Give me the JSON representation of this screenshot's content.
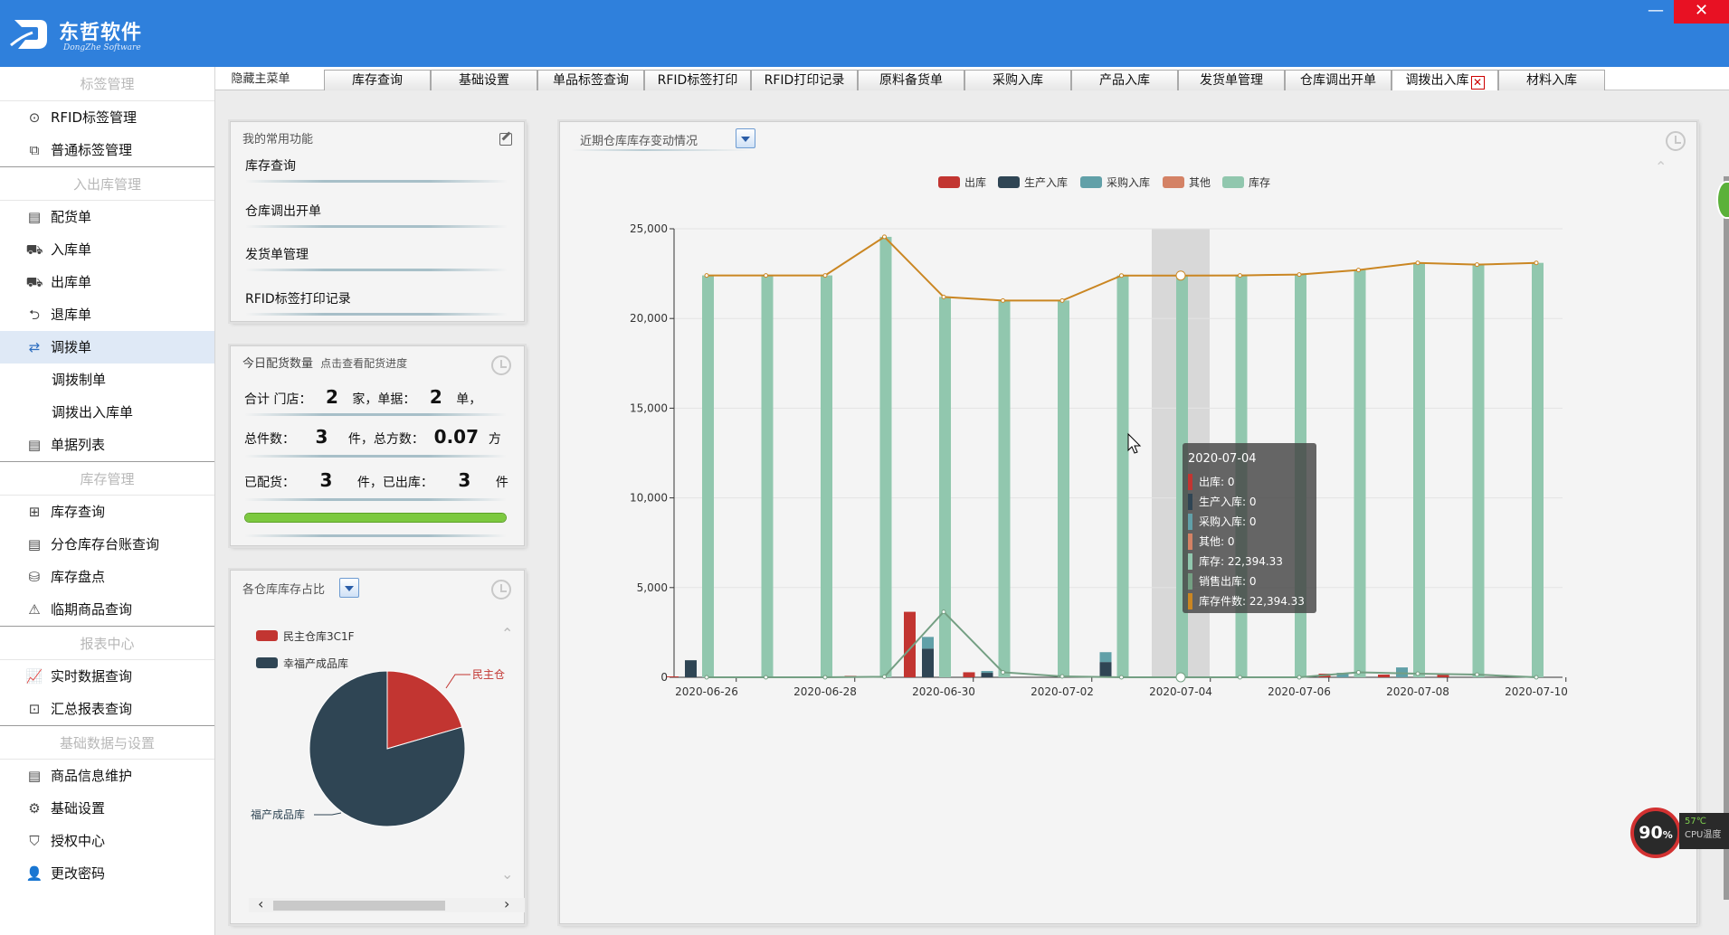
{
  "app": {
    "logo_name": "东哲软件",
    "logo_sub": "DongZhe Software",
    "min_glyph": "—",
    "close_glyph": "✕"
  },
  "sidebar": {
    "sections": [
      {
        "title": "标签管理",
        "items": [
          {
            "label": "RFID标签管理",
            "icon": "rfid-tag-icon",
            "glyph": "⊙"
          },
          {
            "label": "普通标签管理",
            "icon": "tag-icon",
            "glyph": "⧉"
          }
        ]
      },
      {
        "title": "入出库管理",
        "items": [
          {
            "label": "配货单",
            "icon": "printer-icon",
            "glyph": "▤"
          },
          {
            "label": "入库单",
            "icon": "forklift-in-icon",
            "glyph": "⛟"
          },
          {
            "label": "出库单",
            "icon": "truck-out-icon",
            "glyph": "⛟"
          },
          {
            "label": "退库单",
            "icon": "return-icon",
            "glyph": "⮌"
          },
          {
            "label": "调拨单",
            "icon": "transfer-icon",
            "glyph": "⇄",
            "active": true
          },
          {
            "label": "调拨制单",
            "sub": true
          },
          {
            "label": "调拨出入库单",
            "sub": true
          },
          {
            "label": "单据列表",
            "icon": "document-list-icon",
            "glyph": "▤"
          }
        ]
      },
      {
        "title": "库存管理",
        "items": [
          {
            "label": "库存查询",
            "icon": "warehouse-icon",
            "glyph": "⊞"
          },
          {
            "label": "分仓库存台账查询",
            "icon": "ledger-icon",
            "glyph": "▤"
          },
          {
            "label": "库存盘点",
            "icon": "database-icon",
            "glyph": "⛁"
          },
          {
            "label": "临期商品查询",
            "icon": "warning-icon",
            "glyph": "⚠"
          }
        ]
      },
      {
        "title": "报表中心",
        "items": [
          {
            "label": "实时数据查询",
            "icon": "chart-icon",
            "glyph": "📈"
          },
          {
            "label": "汇总报表查询",
            "icon": "report-icon",
            "glyph": "⊡"
          }
        ]
      },
      {
        "title": "基础数据与设置",
        "items": [
          {
            "label": "商品信息维护",
            "icon": "product-icon",
            "glyph": "▤"
          },
          {
            "label": "基础设置",
            "icon": "gear-icon",
            "glyph": "⚙"
          },
          {
            "label": "授权中心",
            "icon": "auth-icon",
            "glyph": "⛉"
          },
          {
            "label": "更改密码",
            "icon": "user-icon",
            "glyph": "👤"
          }
        ]
      }
    ]
  },
  "tabs": {
    "hide_label": "隐藏主菜单",
    "items": [
      "库存查询",
      "基础设置",
      "单品标签查询",
      "RFID标签打印",
      "RFID打印记录",
      "原料备货单",
      "采购入库",
      "产品入库",
      "发货单管理",
      "仓库调出开单",
      "调拨出入库",
      "材料入库"
    ],
    "close_glyph": "✕"
  },
  "favorites": {
    "title": "我的常用功能",
    "items": [
      "库存查询",
      "仓库调出开单",
      "发货单管理",
      "RFID标签打印记录"
    ]
  },
  "today": {
    "title": "今日配货数量",
    "link": "点击查看配货进度",
    "row1": {
      "a": "合计 门店：",
      "stores": "2",
      "b": "家，单据：",
      "docs": "2",
      "c": "单，"
    },
    "row2": {
      "a": "总件数：",
      "pieces": "3",
      "b": "件，总方数：",
      "volume": "0.07",
      "c": "方"
    },
    "row3": {
      "a": "已配货：",
      "allocated": "3",
      "b": "件，已出库：",
      "shipped": "3",
      "c": "件"
    },
    "progress": 1.0
  },
  "pie_panel": {
    "title": "各仓库库存占比",
    "legend": [
      {
        "name": "民主仓库3C1F",
        "color": "#c23531"
      },
      {
        "name": "幸福产成品库",
        "color": "#2f4554"
      }
    ],
    "label_a": "民主仓",
    "label_b": "福产成品库",
    "scroll_left": "‹",
    "scroll_right": "›"
  },
  "main_chart_panel": {
    "title": "近期仓库库存变动情况"
  },
  "chart_data": [
    {
      "type": "bar",
      "title": "近期仓库库存变动情况",
      "categories": [
        "2020-06-26",
        "2020-06-27",
        "2020-06-28",
        "2020-06-29",
        "2020-06-30",
        "2020-07-01",
        "2020-07-02",
        "2020-07-03",
        "2020-07-04",
        "2020-07-05",
        "2020-07-06",
        "2020-07-07",
        "2020-07-08",
        "2020-07-09",
        "2020-07-10"
      ],
      "x_tick_labels": [
        "2020-06-26",
        "2020-06-28",
        "2020-06-30",
        "2020-07-02",
        "2020-07-04",
        "2020-07-06",
        "2020-07-08",
        "2020-07-10"
      ],
      "y_tick_labels": [
        "0",
        "5,000",
        "10,000",
        "15,000",
        "20,000",
        "25,000"
      ],
      "ylim": [
        0,
        25000
      ],
      "series": [
        {
          "name": "出库",
          "color": "#c23531",
          "values": [
            50,
            0,
            0,
            80,
            3650,
            280,
            0,
            0,
            0,
            0,
            0,
            200,
            150,
            150,
            0
          ]
        },
        {
          "name": "生产入库",
          "color": "#2f4554",
          "values": [
            950,
            0,
            0,
            0,
            1600,
            250,
            0,
            850,
            0,
            0,
            0,
            0,
            0,
            0,
            0
          ]
        },
        {
          "name": "采购入库",
          "color": "#61a0a8",
          "values": [
            0,
            0,
            0,
            0,
            650,
            100,
            0,
            550,
            0,
            0,
            0,
            250,
            550,
            0,
            0
          ]
        },
        {
          "name": "其他",
          "color": "#d48265",
          "values": [
            0,
            0,
            0,
            0,
            0,
            0,
            0,
            0,
            0,
            0,
            0,
            0,
            0,
            0,
            0
          ]
        },
        {
          "name": "库存",
          "color": "#91c7ae",
          "values": [
            22400,
            22400,
            22400,
            24550,
            21200,
            21000,
            21000,
            22394,
            22394,
            22400,
            22450,
            22700,
            23100,
            23000,
            23100
          ]
        },
        {
          "name": "销售出库",
          "color": "#749f83",
          "type": "line",
          "values": [
            0,
            0,
            0,
            30,
            3650,
            280,
            50,
            0,
            0,
            0,
            0,
            280,
            200,
            150,
            0
          ]
        },
        {
          "name": "库存件数",
          "color": "#ca8622",
          "type": "line",
          "values": [
            22400,
            22400,
            22400,
            24550,
            21200,
            21000,
            21000,
            22394,
            22394,
            22400,
            22450,
            22700,
            23100,
            23000,
            23100
          ]
        }
      ],
      "tooltip": {
        "date": "2020-07-04",
        "rows": [
          {
            "label": "出库: 0",
            "color": "#c23531"
          },
          {
            "label": "生产入库: 0",
            "color": "#2f4554"
          },
          {
            "label": "采购入库: 0",
            "color": "#61a0a8"
          },
          {
            "label": "其他: 0",
            "color": "#d48265"
          },
          {
            "label": "库存: 22,394.33",
            "color": "#91c7ae"
          },
          {
            "label": "销售出库: 0",
            "color": "#749f83"
          },
          {
            "label": "库存件数: 22,394.33",
            "color": "#ca8622"
          }
        ]
      },
      "highlight_category": "2020-07-04",
      "legend_position": "top-center",
      "grid": true
    },
    {
      "type": "pie",
      "title": "各仓库库存占比",
      "slices": [
        {
          "name": "民主仓库3C1F",
          "value": 0.205,
          "color": "#c23531"
        },
        {
          "name": "幸福产成品库",
          "value": 0.795,
          "color": "#2f4554"
        }
      ]
    }
  ],
  "cpu": {
    "percent": "90",
    "percent_sign": "%",
    "temp": "57℃",
    "label": "CPU温度"
  }
}
